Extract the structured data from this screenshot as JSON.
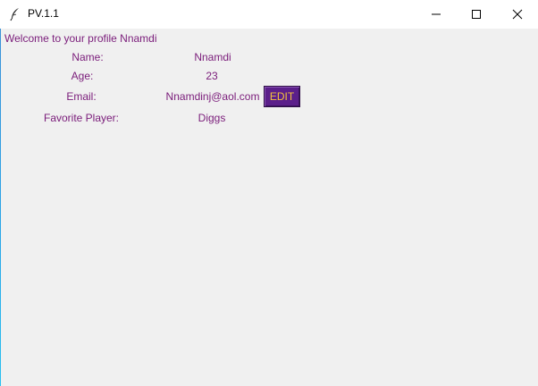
{
  "window": {
    "title": "PV.1.1"
  },
  "profile": {
    "welcome": "Welcome to your profile Nnamdi",
    "name_label": "Name:",
    "name_value": "Nnamdi",
    "age_label": "Age:",
    "age_value": "23",
    "email_label": "Email:",
    "email_value": "Nnamdinj@aol.com",
    "player_label": "Favorite Player:",
    "player_value": "Diggs",
    "edit_label": "EDIT"
  },
  "colors": {
    "text": "#7a1c7a",
    "edit_bg": "#5b1f8a",
    "edit_text": "#f2c23c",
    "window_bg": "#f0f0f0"
  },
  "icons": {
    "app": "feather-icon",
    "minimize": "minimize-icon",
    "maximize": "maximize-icon",
    "close": "close-icon"
  }
}
